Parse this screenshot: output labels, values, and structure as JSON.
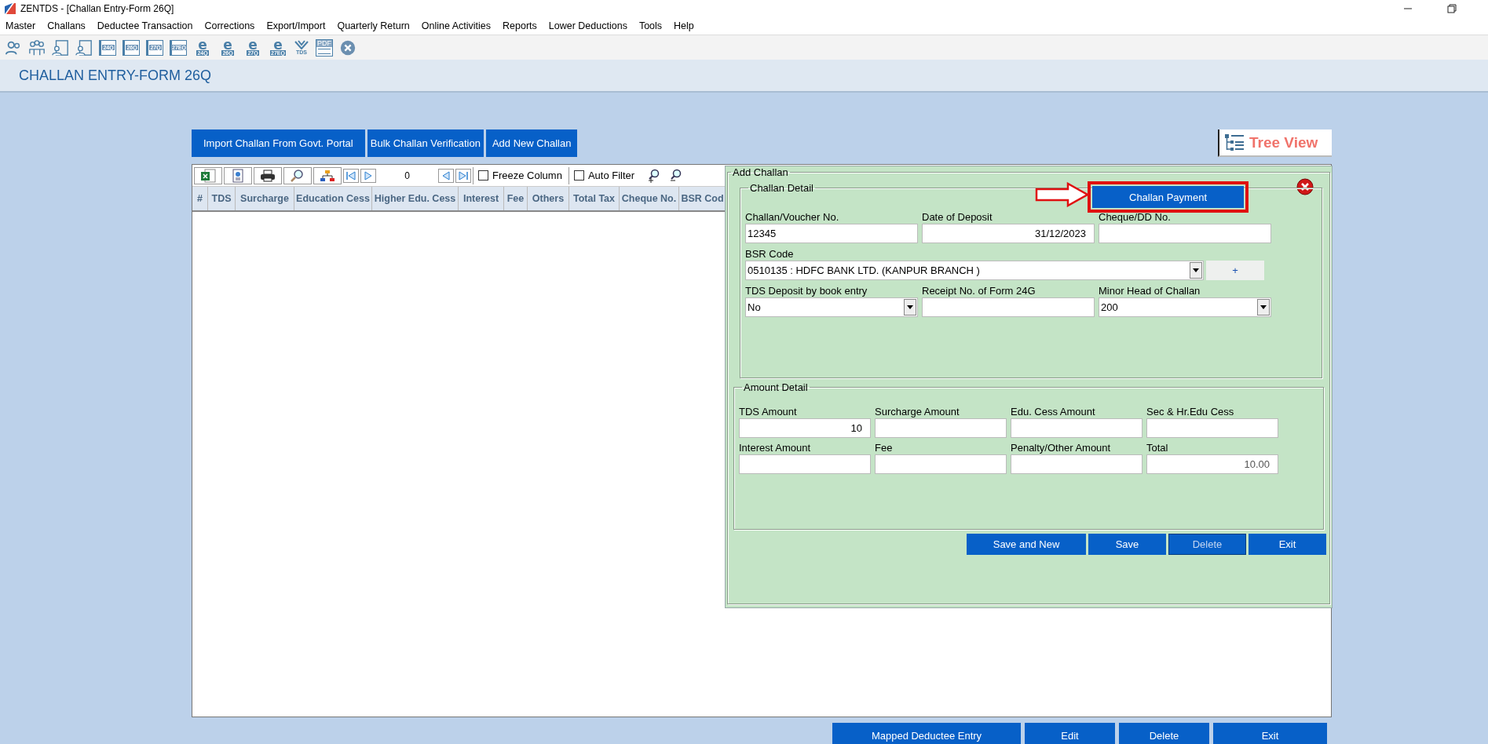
{
  "window": {
    "title": "ZENTDS - [Challan Entry-Form 26Q]"
  },
  "menu": [
    "Master",
    "Challans",
    "Deductee Transaction",
    "Corrections",
    "Export/Import",
    "Quarterly Return",
    "Online Activities",
    "Reports",
    "Lower Deductions",
    "Tools",
    "Help"
  ],
  "toolbar": [
    {
      "kind": "person"
    },
    {
      "kind": "group"
    },
    {
      "kind": "person-doc"
    },
    {
      "kind": "person-doc"
    },
    {
      "kind": "form",
      "label": "24Q"
    },
    {
      "kind": "form",
      "label": "26Q"
    },
    {
      "kind": "form",
      "label": "27Q"
    },
    {
      "kind": "form",
      "label": "27EQ"
    },
    {
      "kind": "eform",
      "glyph": "e",
      "label": "24Q"
    },
    {
      "kind": "eform",
      "glyph": "e",
      "label": "26Q"
    },
    {
      "kind": "eform",
      "glyph": "e",
      "label": "27Q"
    },
    {
      "kind": "eform",
      "glyph": "e",
      "label": "27EQ"
    },
    {
      "kind": "tds",
      "label": "TDS"
    },
    {
      "kind": "pdf",
      "label": "PDF"
    },
    {
      "kind": "close"
    }
  ],
  "page_title": "CHALLAN ENTRY-FORM 26Q",
  "actions": [
    "Import Challan From Govt. Portal",
    "Bulk Challan Verification",
    "Add New Challan"
  ],
  "tree_view": {
    "label": "Tree View"
  },
  "grid": {
    "record_counter": "0",
    "freeze_column": {
      "label": "Freeze Column",
      "checked": false
    },
    "auto_filter": {
      "label": "Auto Filter",
      "checked": false
    },
    "columns": [
      "#",
      "TDS",
      "Surcharge",
      "Education Cess",
      "Higher Edu. Cess",
      "Interest",
      "Fee",
      "Others",
      "Total Tax",
      "Cheque No.",
      "BSR Cod"
    ]
  },
  "dialog": {
    "title": "Add Challan",
    "payment_button": "Challan Payment",
    "challan_detail": {
      "title": "Challan Detail",
      "rows": [
        [
          {
            "label": "Challan/Voucher No.",
            "value": "12345",
            "kind": "text"
          },
          {
            "label": "Date of Deposit",
            "value": "31/12/2023",
            "kind": "date"
          },
          {
            "label": "Cheque/DD No.",
            "kind": "text"
          }
        ],
        [
          {
            "label": "BSR Code",
            "value": "0510135 : HDFC BANK LTD. (KANPUR BRANCH )",
            "kind": "wide-select",
            "add_button": "+"
          }
        ],
        [
          {
            "label": "TDS Deposit by book entry",
            "value": "No",
            "kind": "select"
          },
          {
            "label": "Receipt No. of Form 24G",
            "kind": "text"
          },
          {
            "label": "Minor Head of Challan",
            "value": "200",
            "kind": "select"
          }
        ]
      ]
    },
    "amount_detail": {
      "title": "Amount Detail",
      "fields": [
        {
          "label": "TDS Amount",
          "value": "10",
          "kind": "amount"
        },
        {
          "label": "Surcharge Amount",
          "kind": "amount"
        },
        {
          "label": "Edu. Cess Amount",
          "kind": "amount"
        },
        {
          "label": "Sec & Hr.Edu Cess",
          "kind": "amount"
        },
        {
          "label": "Interest Amount",
          "kind": "amount"
        },
        {
          "label": "Fee",
          "kind": "amount"
        },
        {
          "label": "Penalty/Other Amount",
          "kind": "amount"
        },
        {
          "label": "Total",
          "value": "10.00",
          "kind": "total"
        }
      ]
    },
    "buttons": [
      {
        "label": "Save and New",
        "disabled": false
      },
      {
        "label": "Save",
        "disabled": false
      },
      {
        "label": "Delete",
        "disabled": true
      },
      {
        "label": "Exit",
        "disabled": false
      }
    ]
  },
  "bottom_buttons": [
    "Mapped Deductee Entry",
    "Edit",
    "Delete",
    "Exit"
  ]
}
